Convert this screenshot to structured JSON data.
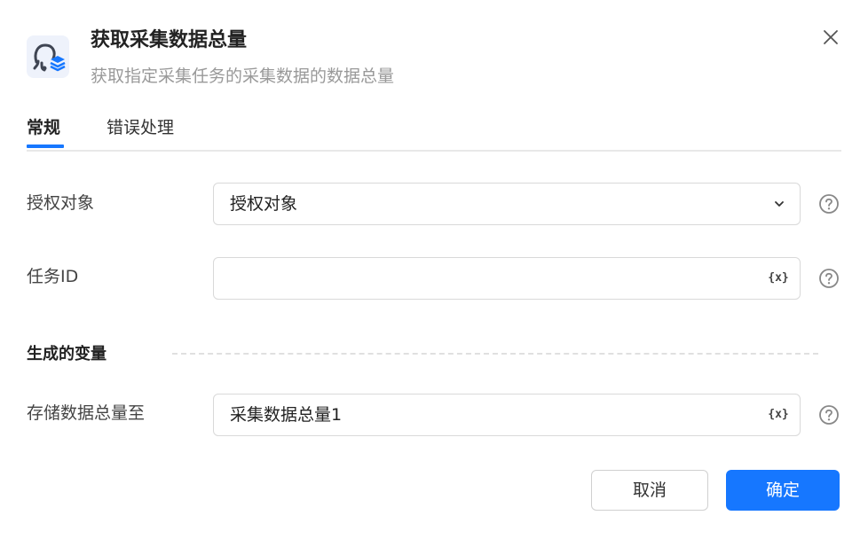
{
  "header": {
    "title": "获取采集数据总量",
    "subtitle": "获取指定采集任务的采集数据的数据总量",
    "icon": "octopus-stack-icon"
  },
  "tabs": [
    {
      "label": "常规",
      "active": true
    },
    {
      "label": "错误处理",
      "active": false
    }
  ],
  "fields": {
    "auth": {
      "label": "授权对象",
      "value": "授权对象"
    },
    "task_id": {
      "label": "任务ID",
      "value": ""
    },
    "output": {
      "label": "存储数据总量至",
      "value": "采集数据总量1"
    }
  },
  "variable_button_label": "{x}",
  "section": {
    "title": "生成的变量"
  },
  "buttons": {
    "cancel": "取消",
    "confirm": "确定"
  },
  "colors": {
    "accent": "#1677ff",
    "icon_bg": "#eef2fb",
    "icon_dark": "#3f4553"
  }
}
